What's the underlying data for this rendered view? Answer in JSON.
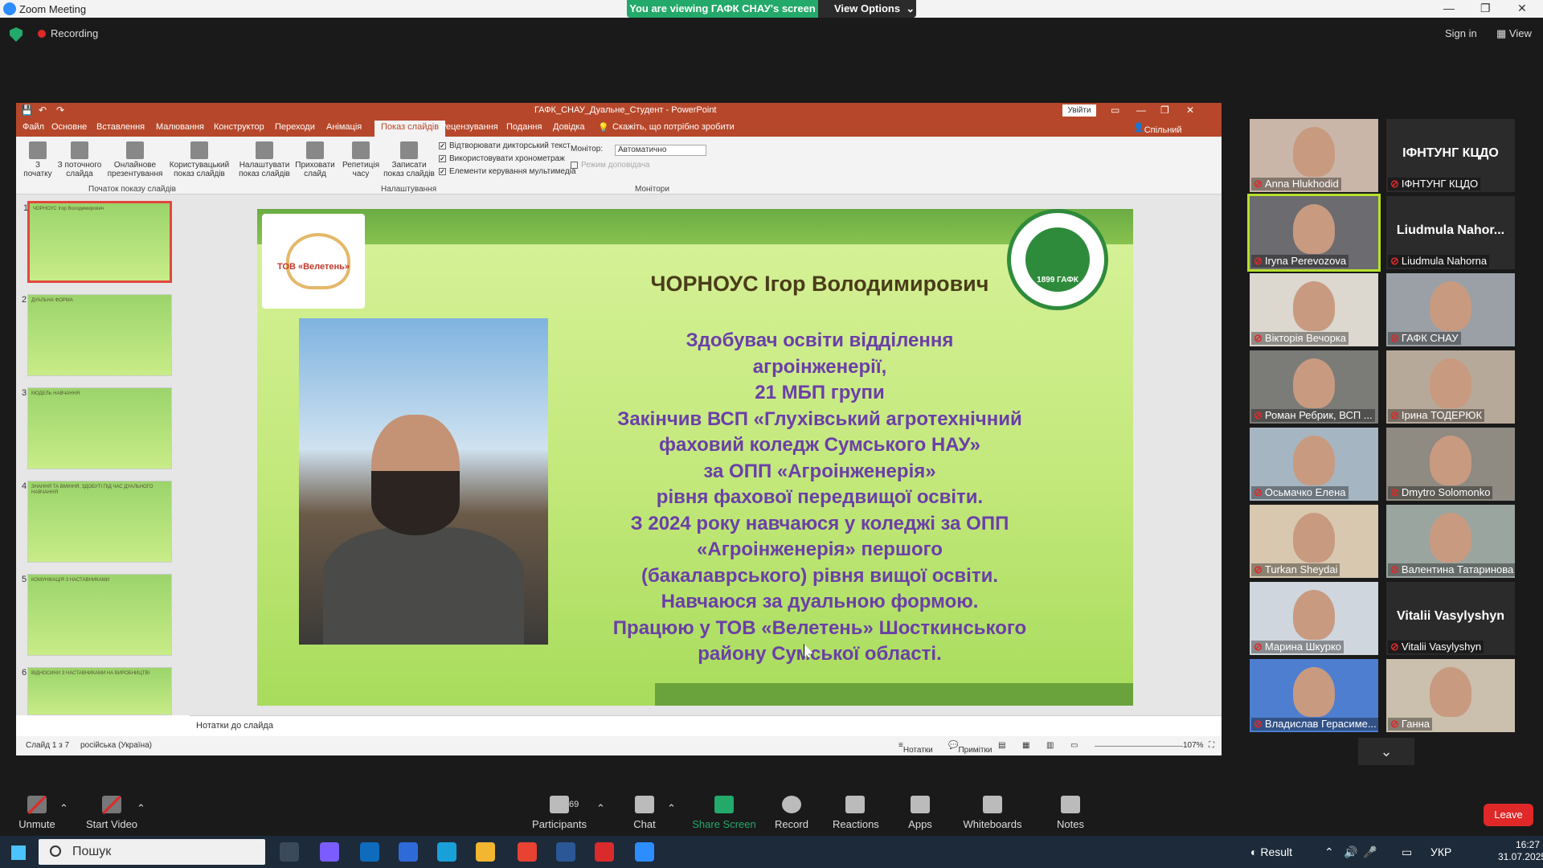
{
  "zoom": {
    "title": "Zoom Meeting",
    "banner_text": "You are viewing ГАФК СНАУ's screen",
    "view_options": "View Options",
    "recording": "Recording",
    "sign_in": "Sign in",
    "view": "View",
    "toolbar": {
      "unmute": "Unmute",
      "start_video": "Start Video",
      "participants": "Participants",
      "participants_count": "69",
      "chat": "Chat",
      "share_screen": "Share Screen",
      "record": "Record",
      "reactions": "Reactions",
      "apps": "Apps",
      "whiteboards": "Whiteboards",
      "notes": "Notes",
      "leave": "Leave"
    },
    "gallery": [
      {
        "name": "Anna Hlukhodid",
        "video": true
      },
      {
        "name": "ІФНТУНГ КЦДО",
        "video": false
      },
      {
        "name": "Iryna Perevozova",
        "video": true,
        "active": true
      },
      {
        "name": "Liudmula Nahorna",
        "display": "Liudmula Nahor...",
        "video": false
      },
      {
        "name": "Вікторія Вечорка",
        "video": true
      },
      {
        "name": "ГАФК СНАУ",
        "video": true
      },
      {
        "name": "Роман Ребрик, ВСП ...",
        "video": true
      },
      {
        "name": "Ірина ТОДЕРЮК",
        "video": true
      },
      {
        "name": "Осьмачко Елена",
        "video": true
      },
      {
        "name": "Dmytro Solomonko",
        "video": true
      },
      {
        "name": "Turkan Sheydai",
        "video": true
      },
      {
        "name": "Валентина Татаринова",
        "video": true
      },
      {
        "name": "Марина Шкурко",
        "video": true
      },
      {
        "name": "Vitalii Vasylyshyn",
        "video": false
      },
      {
        "name": "Владислав Герасиме...",
        "video": true
      },
      {
        "name": "Ганна",
        "video": true
      }
    ]
  },
  "ppt": {
    "title": "ГАФК_СНАУ_Дуальне_Студент  -  PowerPoint",
    "sign_in_button": "Увійти",
    "share": "Спільний доступ",
    "tabs": [
      "Файл",
      "Основне",
      "Вставлення",
      "Малювання",
      "Конструктор",
      "Переходи",
      "Анімація",
      "Показ слайдів",
      "Рецензування",
      "Подання",
      "Довідка"
    ],
    "active_tab": "Показ слайдів",
    "tell_me": "Скажіть, що потрібно зробити",
    "ribbon": {
      "from_start": "З початку",
      "from_current": "З поточного слайда",
      "online": "Онлайнове презентування",
      "custom": "Користувацький показ слайдів",
      "group_start": "Початок показу слайдів",
      "setup": "Налаштувати показ слайдів",
      "hide": "Приховати слайд",
      "rehearse": "Репетиція часу",
      "record": "Записати показ слайдів",
      "chk_narration": "Відтворювати дикторський текст",
      "chk_timings": "Використовувати хронометраж",
      "chk_media": "Елементи керування мультимедіа",
      "group_setup": "Налаштування",
      "monitor_label": "Монітор:",
      "monitor_value": "Автоматично",
      "presenter_view": "Режим доповідача",
      "group_monitors": "Монітори"
    },
    "notes_placeholder": "Нотатки до слайда",
    "status": {
      "slide": "Слайд 1 з 7",
      "language": "російська (Україна)",
      "notes": "Нотатки",
      "comments": "Примітки",
      "zoom": "107%"
    },
    "thumbnails": [
      {
        "num": "1",
        "text": "ЧОРНОУС Ігор Володимирович"
      },
      {
        "num": "2",
        "text": "ДУАЛЬНА ФОРМА"
      },
      {
        "num": "3",
        "text": "МОДЕЛЬ НАВЧАННЯ"
      },
      {
        "num": "4",
        "text": "ЗНАННЯ ТА ВМІННЯ, ЗДОБУТІ ПІД ЧАС ДУАЛЬНОГО НАВЧАННЯ"
      },
      {
        "num": "5",
        "text": "КОМУНІКАЦІЯ З НАСТАВНИКАМИ"
      },
      {
        "num": "6",
        "text": "ВІДНОСИНИ З НАСТАВНИКАМИ НА ВИРОБНИЦТВІ"
      }
    ],
    "slide": {
      "name": "ЧОРНОУС Ігор Володимирович",
      "logo_text": "ТОВ «Велетень»",
      "seal_text": "1899 ГАФК",
      "body": [
        "Здобувач освіти відділення",
        "агроінженерії,",
        "21 МБП групи",
        "Закінчив ВСП «Глухівський агротехнічний",
        "фаховий коледж  Сумського НАУ»",
        "за ОПП «Агроінженерія»",
        "рівня фахової передвищої освіти.",
        "З 2024 року навчаюся у коледжі за ОПП",
        "«Агроінженерія» першого",
        "(бакалаврського) рівня вищої освіти.",
        "Навчаюся за дуальною формою.",
        "Працюю у ТОВ «Велетень» Шосткинського",
        "району Сумської області."
      ]
    }
  },
  "taskbar": {
    "search": "Пошук",
    "result": "Result",
    "lang": "УКР",
    "time": "16:27",
    "date": "31.07.2025"
  }
}
